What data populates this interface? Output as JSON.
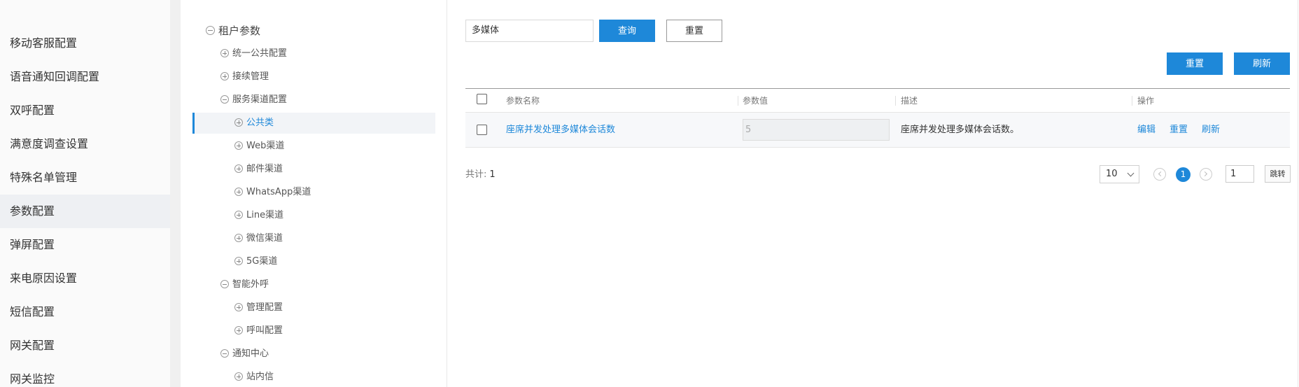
{
  "sidebar": {
    "items": [
      {
        "label": "移动客服配置"
      },
      {
        "label": "语音通知回调配置"
      },
      {
        "label": "双呼配置"
      },
      {
        "label": "满意度调查设置"
      },
      {
        "label": "特殊名单管理"
      },
      {
        "label": "参数配置",
        "active": true
      },
      {
        "label": "弹屏配置"
      },
      {
        "label": "来电原因设置"
      },
      {
        "label": "短信配置"
      },
      {
        "label": "网关配置"
      },
      {
        "label": "网关监控"
      }
    ]
  },
  "tree": {
    "root": "租户参数",
    "nodes": {
      "unified": "统一公共配置",
      "continuation": "接续管理",
      "service_channel": "服务渠道配置",
      "public": "公共类",
      "web": "Web渠道",
      "mail": "邮件渠道",
      "whatsapp": "WhatsApp渠道",
      "line": "Line渠道",
      "wechat": "微信渠道",
      "fiveg": "5G渠道",
      "smart_outbound": "智能外呼",
      "manage_config": "管理配置",
      "call_config": "呼叫配置",
      "notify_center": "通知中心",
      "inbox": "站内信"
    }
  },
  "search": {
    "value": "多媒体",
    "query_label": "查询",
    "reset_label": "重置"
  },
  "toolbar": {
    "reset_label": "重置",
    "refresh_label": "刷新"
  },
  "table": {
    "headers": {
      "name": "参数名称",
      "value": "参数值",
      "desc": "描述",
      "ops": "操作"
    },
    "rows": [
      {
        "name": "座席并发处理多媒体会话数",
        "value": "5",
        "desc": "座席并发处理多媒体会话数。",
        "ops": {
          "edit": "编辑",
          "reset": "重置",
          "refresh": "刷新"
        }
      }
    ]
  },
  "pagination": {
    "total_label": "共计:",
    "total": "1",
    "page_size": "10",
    "current_page": "1",
    "jump_value": "1",
    "jump_label": "跳转"
  },
  "colors": {
    "accent": "#1e88d9",
    "sidebar_bg": "#fafafa",
    "active_bg": "#eef0f3"
  }
}
